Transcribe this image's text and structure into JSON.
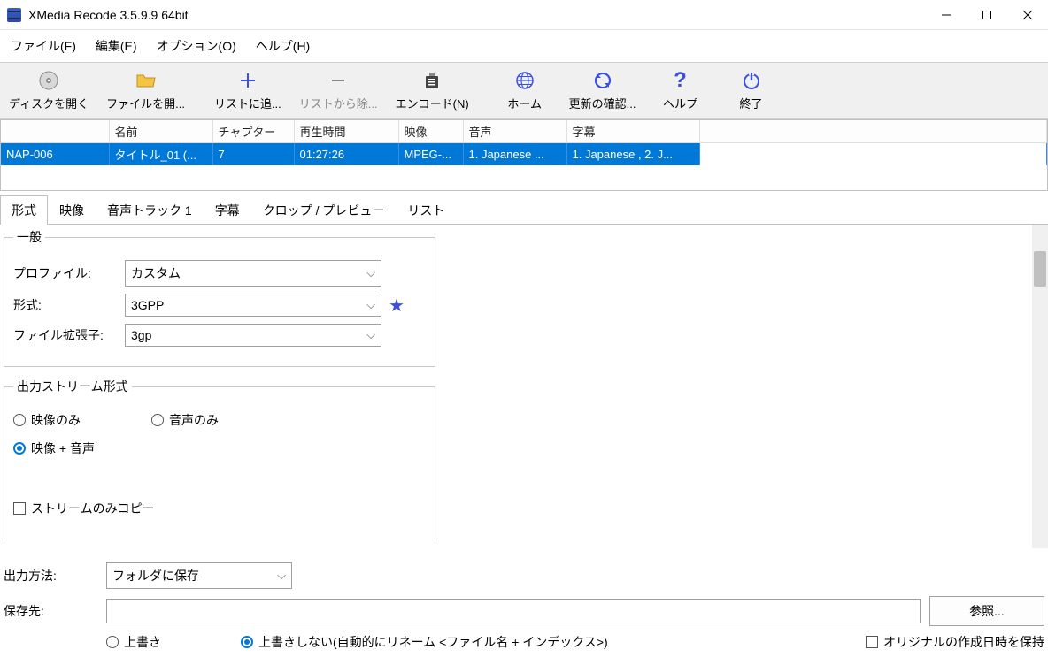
{
  "titlebar": {
    "title": "XMedia Recode 3.5.9.9 64bit"
  },
  "menu": {
    "file": "ファイル(F)",
    "edit": "編集(E)",
    "options": "オプション(O)",
    "help": "ヘルプ(H)"
  },
  "toolbar": {
    "openDisc": "ディスクを開く",
    "openFile": "ファイルを開...",
    "addList": "リストに追...",
    "removeList": "リストから除...",
    "encode": "エンコード(N)",
    "home": "ホーム",
    "checkUpdate": "更新の確認...",
    "help": "ヘルプ",
    "exit": "終了"
  },
  "table": {
    "headers": {
      "disc": "",
      "name": "名前",
      "chapter": "チャプター",
      "duration": "再生時間",
      "video": "映像",
      "audio": "音声",
      "subtitle": "字幕"
    },
    "row": {
      "disc": "NAP-006",
      "name": "タイトル_01 (...",
      "chapter": "7",
      "duration": "01:27:26",
      "video": "MPEG-...",
      "audio": "1. Japanese ...",
      "subtitle": "1. Japanese , 2. J..."
    }
  },
  "tabs": {
    "format": "形式",
    "video": "映像",
    "audioTrack": "音声トラック 1",
    "subtitle": "字幕",
    "crop": "クロップ / プレビュー",
    "list": "リスト"
  },
  "general": {
    "legend": "一般",
    "profileLabel": "プロファイル:",
    "profileValue": "カスタム",
    "formatLabel": "形式:",
    "formatValue": "3GPP",
    "extLabel": "ファイル拡張子:",
    "extValue": "3gp"
  },
  "outputStream": {
    "legend": "出力ストリーム形式",
    "videoOnly": "映像のみ",
    "audioOnly": "音声のみ",
    "videoAudio": "映像 + 音声",
    "streamCopy": "ストリームのみコピー"
  },
  "output": {
    "methodLabel": "出力方法:",
    "methodValue": "フォルダに保存",
    "destLabel": "保存先:",
    "destValue": "",
    "browse": "参照...",
    "overwrite": "上書き",
    "noOverwrite": "上書きしない(自動的にリネーム <ファイル名 + インデックス>)",
    "keepOriginalDate": "オリジナルの作成日時を保持"
  }
}
